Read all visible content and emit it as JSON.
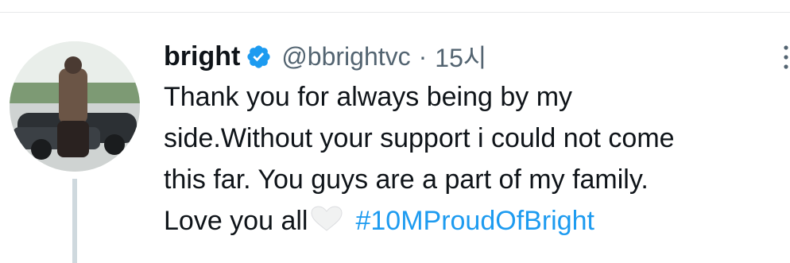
{
  "tweet": {
    "display_name": "bright",
    "handle": "@bbrightvc",
    "separator": "·",
    "time": "15시",
    "text_line1": "Thank you for always being by my",
    "text_line2": "side.Without your support i could not come",
    "text_line3": "this far. You guys are a part of my family.",
    "text_line4": "Love you all",
    "emoji": "white-heart-icon",
    "hashtag": "#10MProudOfBright"
  },
  "colors": {
    "name": "#0f1419",
    "secondary": "#536471",
    "link": "#1d9bf0",
    "verified": "#1d9bf0",
    "thread_line": "#cfd9de",
    "divider": "#e7e9ea"
  }
}
